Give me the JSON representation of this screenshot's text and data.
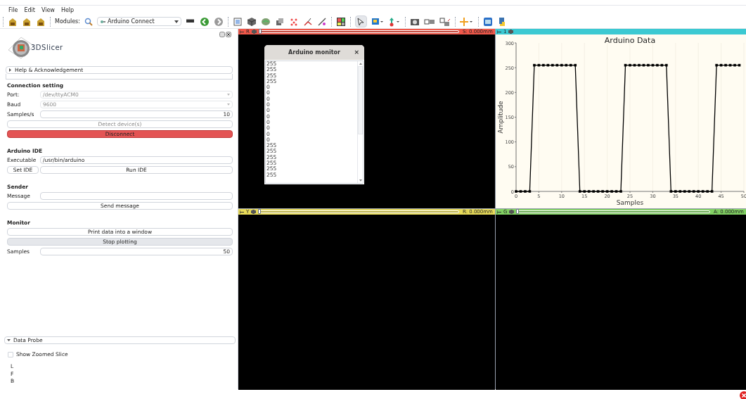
{
  "menu": [
    "File",
    "Edit",
    "View",
    "Help"
  ],
  "toolbar": {
    "modules_label": "Modules:",
    "module": "Arduino Connect"
  },
  "logo_text": "3DSlicer",
  "help_section": {
    "label": "Help & Acknowledgement",
    "expanded": false
  },
  "sections": [
    {
      "title": "Connection setting",
      "rows": [
        {
          "kind": "combo",
          "label": "Port:",
          "value": "/dev/ttyACM0",
          "disabled": true
        },
        {
          "kind": "combo",
          "label": "Baud",
          "value": "9600",
          "disabled": true
        },
        {
          "kind": "number",
          "label": "Samples/s",
          "value": "10"
        },
        {
          "kind": "button",
          "label": "Detect device(s)",
          "disabled": true,
          "pressed": false
        },
        {
          "kind": "danger_button",
          "label": "Disconnect",
          "disabled": false
        }
      ]
    },
    {
      "title": "Arduino IDE",
      "rows": [
        {
          "kind": "text",
          "label": "Executable",
          "value": "/usr/bin/arduino"
        },
        {
          "kind": "button_pair",
          "buttons": [
            {
              "label": "Set IDE",
              "disabled": false,
              "pressed": false
            },
            {
              "label": "Run IDE",
              "disabled": false,
              "pressed": false
            }
          ]
        }
      ]
    },
    {
      "title": "Sender",
      "rows": [
        {
          "kind": "text",
          "label": "Message"
        },
        {
          "kind": "button",
          "label": "Send message",
          "disabled": false,
          "pressed": false
        }
      ]
    },
    {
      "title": "Monitor",
      "rows": [
        {
          "kind": "button",
          "label": "Print data into a window",
          "disabled": false,
          "pressed": false
        },
        {
          "kind": "button",
          "label": "Stop plotting",
          "disabled": false,
          "pressed": true
        },
        {
          "kind": "number",
          "label": "Samples",
          "value": "50"
        }
      ]
    }
  ],
  "data_probe": {
    "label": "Data Probe",
    "expanded": true,
    "checkbox": {
      "label": "Show Zoomed Slice",
      "checked": false
    },
    "coords": [
      "L",
      "F",
      "B"
    ]
  },
  "views": [
    {
      "kind": "slice",
      "letter": "R",
      "color": "#f0584a",
      "readout": "S: 0.000mm",
      "level": 0
    },
    {
      "kind": "chart",
      "letter": "1",
      "color": "#3cc9d2",
      "chart_data": {
        "type": "line",
        "title": "Arduino Data",
        "xlabel": "Samples",
        "ylabel": "Amplitude",
        "grid": true,
        "xlim": [
          0,
          50
        ],
        "ylim": [
          0,
          300
        ],
        "xticks": [
          0,
          5,
          10,
          15,
          20,
          25,
          30,
          35,
          40,
          45,
          50
        ],
        "yticks": [
          0,
          50,
          100,
          150,
          200,
          250,
          300
        ],
        "x": [
          0,
          1,
          2,
          3,
          4,
          5,
          6,
          7,
          8,
          9,
          10,
          11,
          12,
          13,
          14,
          15,
          16,
          17,
          18,
          19,
          20,
          21,
          22,
          23,
          24,
          25,
          26,
          27,
          28,
          29,
          30,
          31,
          32,
          33,
          34,
          35,
          36,
          37,
          38,
          39,
          40,
          41,
          42,
          43,
          44,
          45,
          46,
          47,
          48,
          49
        ],
        "series": [
          {
            "color": "#000000",
            "marker": "square",
            "values": [
              0,
              0,
              0,
              0,
              255,
              255,
              255,
              255,
              255,
              255,
              255,
              255,
              255,
              255,
              0,
              0,
              0,
              0,
              0,
              0,
              0,
              0,
              0,
              0,
              255,
              255,
              255,
              255,
              255,
              255,
              255,
              255,
              255,
              255,
              0,
              0,
              0,
              0,
              0,
              0,
              0,
              0,
              0,
              0,
              255,
              255,
              255,
              255,
              255,
              255
            ]
          }
        ]
      }
    },
    {
      "kind": "slice",
      "letter": "Y",
      "color": "#e9dc5a",
      "readout": "R: 0.000mm",
      "level": 0
    },
    {
      "kind": "slice",
      "letter": "G",
      "color": "#82d163",
      "readout": "A: 0.000mm",
      "level": 0
    }
  ],
  "monitor": {
    "title": "Arduino monitor",
    "close": "×",
    "lines": [
      "255",
      "255",
      "255",
      "255",
      "0",
      "0",
      "0",
      "0",
      "0",
      "0",
      "0",
      "0",
      "0",
      "0",
      "255",
      "255",
      "255",
      "255",
      "255",
      "255"
    ]
  }
}
